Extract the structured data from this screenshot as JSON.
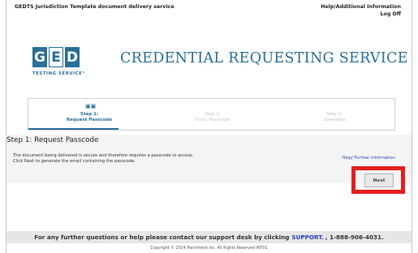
{
  "header": {
    "service_title": "GEDTS Jurisdiction Template document delivery service",
    "help_link": "Help/Additional Information",
    "logoff_link": "Log Off"
  },
  "logo": {
    "letters": [
      "G",
      "E",
      "D"
    ],
    "subtitle": "TESTING SERVICE°"
  },
  "page_heading": "CREDENTIAL REQUESTING SERVICE",
  "steps": [
    {
      "number": "Step 1:",
      "label": "Request Passcode",
      "state": "active"
    },
    {
      "number": "Step 2:",
      "label": "Enter Passcode",
      "state": "inactive"
    },
    {
      "number": "Step 3:",
      "label": "Download",
      "state": "inactive"
    }
  ],
  "main": {
    "section_title": "Step 1: Request Passcode",
    "body_line1": "The document being delivered is secure and therefore requires a passcode to access.",
    "body_line2": "Click Next to generate the email containing the passcode.",
    "info_link": "Help/ Further Information",
    "next_button": "Next"
  },
  "footer": {
    "contact_text": "For any further questions or help please contact our support desk by clicking",
    "support_link": "SUPPORT.",
    "phone": ", 1-888-906-4031.",
    "copyright": "Copyright © 2014 Parchment Inc. All Rights Reserved INT01"
  },
  "colors": {
    "brand_blue": "#2a6f98",
    "highlight_red": "#e61e1e",
    "link_blue": "#2b3fc8"
  }
}
